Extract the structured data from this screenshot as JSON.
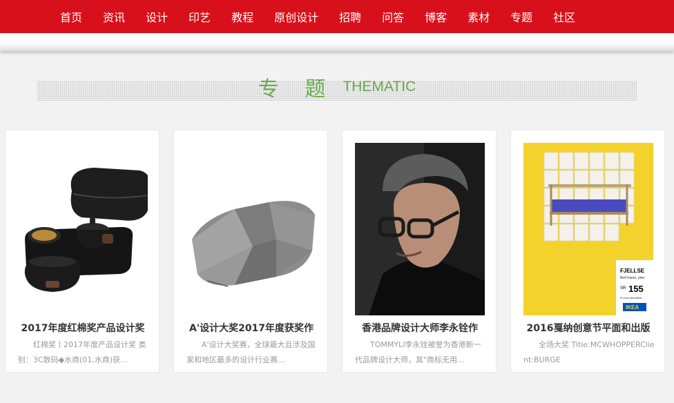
{
  "nav": {
    "items": [
      "首页",
      "资讯",
      "设计",
      "印艺",
      "教程",
      "原创设计",
      "招聘",
      "问答",
      "博客",
      "素材",
      "专题",
      "社区"
    ]
  },
  "section": {
    "title_cn": "专 题",
    "title_en": "THEMATIC"
  },
  "cards": [
    {
      "title": "2017年度红棉奖产品设计奖",
      "desc": "红棉奖丨2017年度产品设计奖 类别：3C数码◆水商(01.水商)获...",
      "image": "tea-set-photo"
    },
    {
      "title": "A'设计大奖2017年度获奖作",
      "desc": "A'设计大奖赛，全球最大且涉及国家和地区最多的设计行业赛...",
      "image": "cushion-photo"
    },
    {
      "title": "香港品牌设计大师李永铨作",
      "desc": "TOMMYLI李永铨被誉为香港新一代品牌设计大师，其\"商标无用...",
      "image": "portrait-photo"
    },
    {
      "title": "2016戛纳创意节平面和出版",
      "desc": "全场大奖 Title:MCWHOPPERClient:BURGE",
      "image": "ikea-poster",
      "poster": {
        "product": "FJELLSE",
        "sub": "Bed frame, pine",
        "price_prefix": "SR",
        "price": "155",
        "tagline": "It's that affordable.",
        "brand": "IKEA"
      }
    }
  ],
  "colors": {
    "nav_bg": "#d8101b",
    "heading_green": "#6aa84f",
    "poster_yellow": "#f3d22c"
  }
}
